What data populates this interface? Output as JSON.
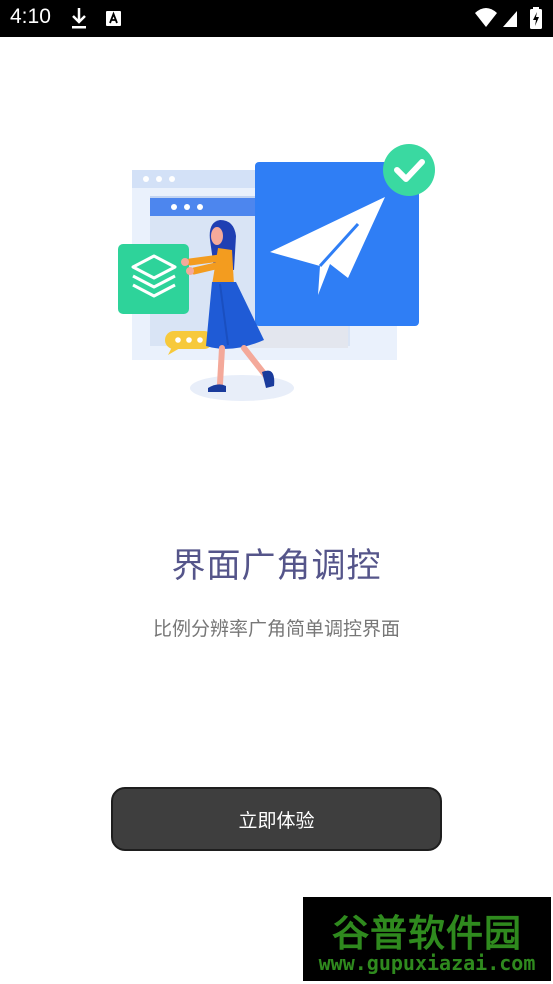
{
  "status_bar": {
    "time": "4:10",
    "icons": [
      "download-icon",
      "notification-a-icon",
      "wifi-icon",
      "cellular-signal-icon",
      "battery-icon"
    ]
  },
  "illustration": {
    "icon_name": "paper-plane-illustration",
    "colors": {
      "blue": "#2f7ef5",
      "green": "#2ed39a",
      "teal": "#3ad9a1",
      "yellow": "#f7c93b",
      "orange": "#f39c1f",
      "dress": "#1f5bd6"
    }
  },
  "onboarding": {
    "title": "界面广角调控",
    "subtitle": "比例分辨率广角简单调控界面",
    "cta_label": "立即体验"
  },
  "watermark": {
    "title": "谷普软件园",
    "url": "www.gupuxiazai.com"
  },
  "colors": {
    "status_bar_bg": "#000000",
    "title": "#55558a",
    "subtitle": "#777777",
    "button_bg": "#3e3e3e",
    "button_text": "#ffffff",
    "watermark_text": "#2f8a1e"
  }
}
